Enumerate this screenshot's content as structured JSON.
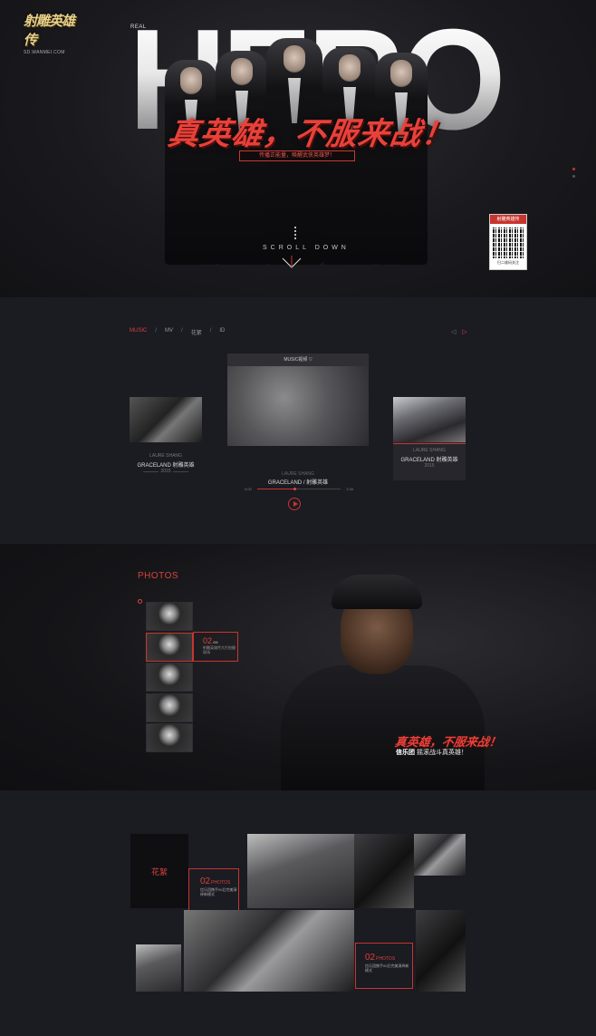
{
  "brand": {
    "logo_text": "射雕英雄传",
    "logo_url": "SD.WANMEI.COM"
  },
  "hero": {
    "real_label": "REAL",
    "hero_word": "HERO",
    "slogan": "真英雄，不服来战！",
    "sub_slogan": "传播正能量，唤醒武侠英雄梦！",
    "scroll_label": "SCROLL  DOWN",
    "qr_title": "射雕英雄传",
    "qr_caption": "扫二维码关注"
  },
  "music": {
    "tabs": [
      "MUSIC",
      "MV",
      "花絮",
      "ID"
    ],
    "active_tab": 0,
    "mv_label": "MUSIC视频 ▽",
    "cards": [
      {
        "artist": "LAURE SHANG",
        "song": "GRACELAND 射雕英雄",
        "year": "2015"
      },
      {
        "artist": "LAURE SHANG",
        "song": "GRACELAND /  射雕英雄",
        "year": ""
      },
      {
        "artist": "LAURE SHANG",
        "song": "GRACELAND 射雕英雄",
        "year": "2015"
      }
    ],
    "time_start": "0:00",
    "time_end": "3:36",
    "progress": 0.45
  },
  "photos": {
    "title": "PHOTOS",
    "thumb_count": 5,
    "active_index": 1,
    "active_num": "02",
    "active_num_suffix": "/06",
    "active_desc": "射雕英雄传大片拍摄现场",
    "slogan": "真英雄，不服来战！",
    "sub_band": "信乐团",
    "sub_text": "摇滚战斗真英雄！"
  },
  "gallery": {
    "label": "花絮",
    "boxes": [
      {
        "num": "02",
        "suffix": "PHOTOS",
        "desc": "信乐团携手00后完美演绎新模式"
      },
      {
        "num": "02",
        "suffix": "PHOTOS",
        "desc": "信乐团携手00后完美演绎新模式"
      }
    ]
  },
  "colors": {
    "accent": "#d9423b",
    "background": "#1b1b22"
  }
}
